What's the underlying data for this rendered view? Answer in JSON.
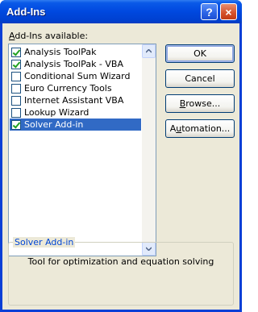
{
  "window": {
    "title": "Add-Ins",
    "help_glyph": "?",
    "close_glyph": "×"
  },
  "list": {
    "label_prefix": "",
    "label_accel": "A",
    "label_rest": "dd-Ins available:",
    "items": [
      {
        "label": "Analysis ToolPak",
        "checked": true,
        "selected": false
      },
      {
        "label": "Analysis ToolPak - VBA",
        "checked": true,
        "selected": false
      },
      {
        "label": "Conditional Sum Wizard",
        "checked": false,
        "selected": false
      },
      {
        "label": "Euro Currency Tools",
        "checked": false,
        "selected": false
      },
      {
        "label": "Internet Assistant VBA",
        "checked": false,
        "selected": false
      },
      {
        "label": "Lookup Wizard",
        "checked": false,
        "selected": false
      },
      {
        "label": "Solver Add-in",
        "checked": true,
        "selected": true
      }
    ]
  },
  "buttons": {
    "ok": "OK",
    "cancel": "Cancel",
    "browse_accel": "B",
    "browse_rest": "rowse...",
    "automation_accel": "u",
    "automation_pre": "A",
    "automation_rest": "tomation..."
  },
  "details": {
    "title": "Solver Add-in",
    "description": "Tool for optimization and equation solving"
  },
  "colors": {
    "title_bar": "#0048df",
    "selection": "#316ac5",
    "dialog_bg": "#ece9d8",
    "group_title": "#0046d5"
  }
}
